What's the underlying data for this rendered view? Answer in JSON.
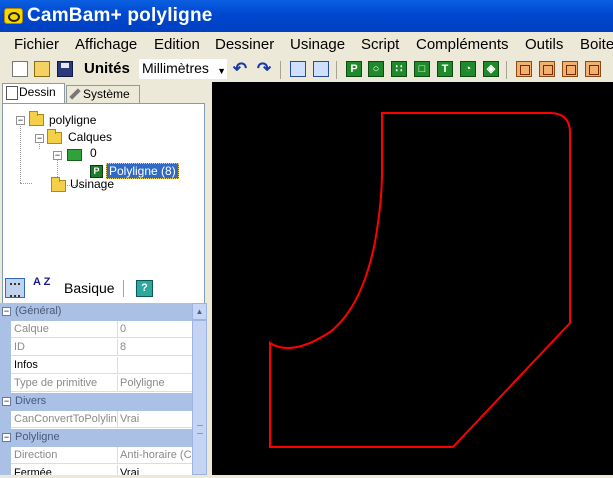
{
  "window": {
    "title": "CamBam+  polyligne"
  },
  "menu": [
    "Fichier",
    "Affichage",
    "Edition",
    "Dessiner",
    "Usinage",
    "Script",
    "Compléments",
    "Outils",
    "Boite"
  ],
  "toolbar": {
    "units_label": "Unités",
    "units_value": "Millimètres",
    "icons": [
      "new-file",
      "open-folder",
      "save",
      "undo",
      "redo",
      "snap-points",
      "snap-grid",
      "polyline",
      "circle",
      "points",
      "rectangle",
      "text",
      "arc",
      "3d-surface",
      "machining-1",
      "machining-2",
      "machining-3",
      "machining-4"
    ]
  },
  "tabs": {
    "dessin": "Dessin",
    "systeme": "Système"
  },
  "tree": {
    "root": "polyligne",
    "layers_folder": "Calques",
    "layer": "0",
    "object": "Polyligne (8)",
    "machining": "Usinage"
  },
  "properties": {
    "view_label": "Basique",
    "help_label": "?",
    "sort_label": "A Z",
    "rows": [
      {
        "type": "category",
        "label": "(Général)",
        "expander": "⊟"
      },
      {
        "type": "prop",
        "name": "Calque",
        "value": "0",
        "readonly": true
      },
      {
        "type": "prop",
        "name": "ID",
        "value": "8",
        "readonly": true
      },
      {
        "type": "prop",
        "name": "Infos",
        "value": "",
        "readonly": false
      },
      {
        "type": "prop",
        "name": "Type de primitive",
        "value": "Polyligne",
        "readonly": true
      },
      {
        "type": "category",
        "label": "Divers",
        "expander": "⊟"
      },
      {
        "type": "prop",
        "name": "CanConvertToPolyline",
        "value": "Vrai",
        "readonly": true
      },
      {
        "type": "category",
        "label": "Polyligne",
        "expander": "⊟"
      },
      {
        "type": "prop",
        "name": "Direction",
        "value": "Anti-horaire (CC",
        "readonly": true
      },
      {
        "type": "prop",
        "name": "Fermée",
        "value": "Vrai",
        "readonly": false
      }
    ]
  },
  "drawing": {
    "background": "#000000",
    "stroke": "#ff0000",
    "shape": "closed-polyline"
  }
}
